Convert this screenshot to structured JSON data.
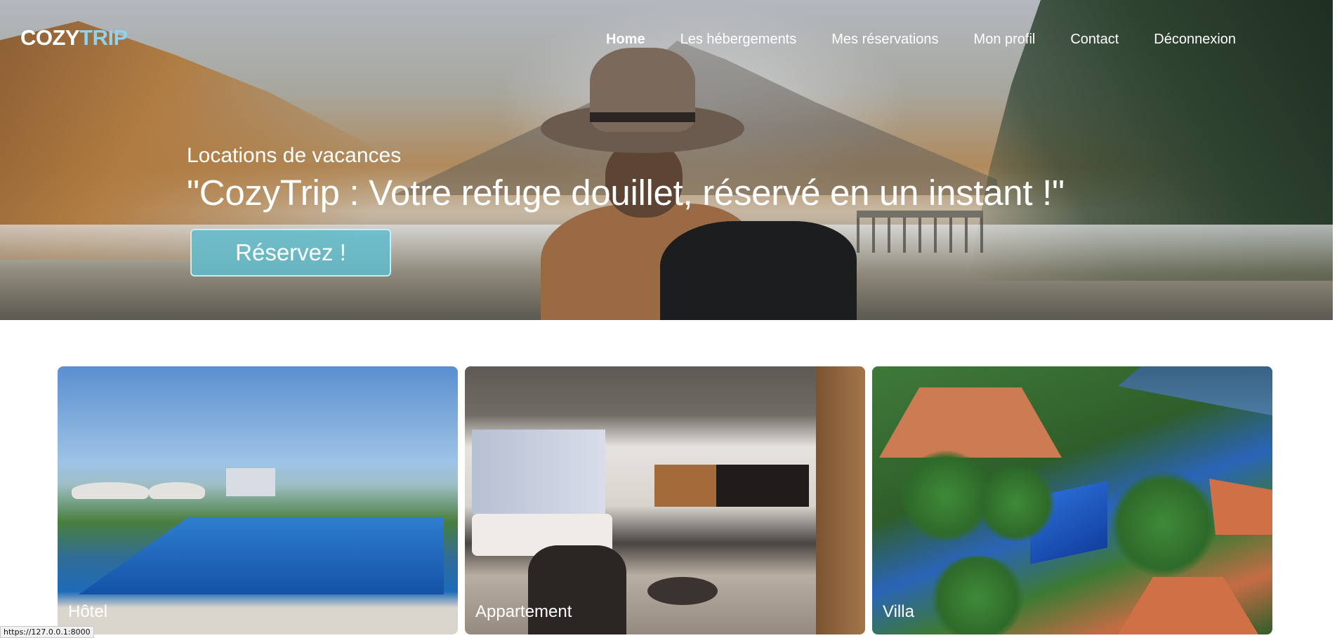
{
  "brand": {
    "logo_part1": "COZY",
    "logo_part2": "TRIP",
    "color_white": "#ffffff",
    "color_accent": "#8fd3ee"
  },
  "nav": {
    "items": [
      {
        "label": "Home",
        "active": true
      },
      {
        "label": "Les hébergements",
        "active": false
      },
      {
        "label": "Mes réservations",
        "active": false
      },
      {
        "label": "Mon profil",
        "active": false
      },
      {
        "label": "Contact",
        "active": false
      },
      {
        "label": "Déconnexion",
        "active": false
      }
    ]
  },
  "hero": {
    "kicker": "Locations de vacances",
    "headline": "\"CozyTrip : Votre refuge douillet, réservé en un instant !\"",
    "cta_label": "Réservez !",
    "cta_color": "#60bccc"
  },
  "cards": [
    {
      "label": "Hôtel"
    },
    {
      "label": "Appartement"
    },
    {
      "label": "Villa"
    }
  ],
  "status_bar": {
    "url": "https://127.0.0.1:8000"
  }
}
